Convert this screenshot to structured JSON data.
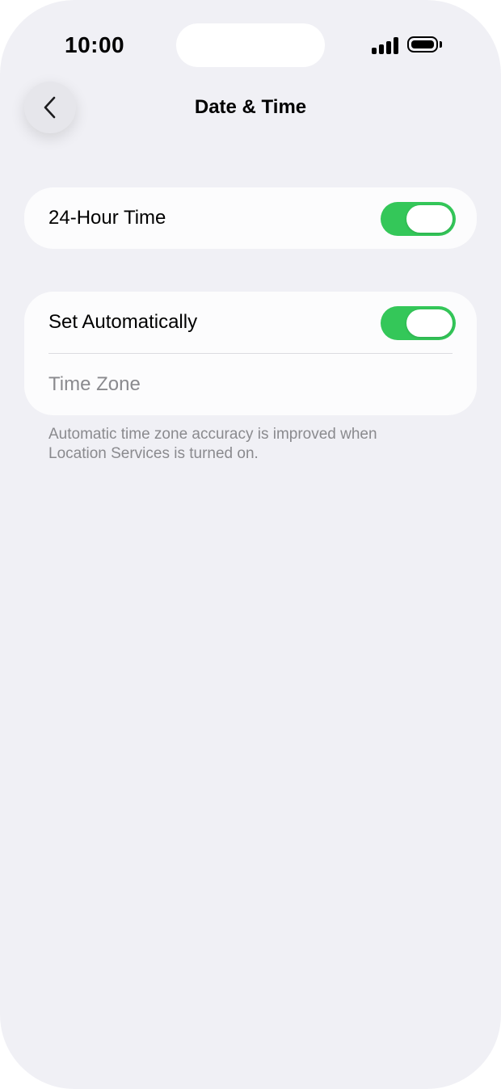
{
  "status_bar": {
    "time": "10:00",
    "signal_icon": "cellular-signal-icon",
    "battery_icon": "battery-icon"
  },
  "nav": {
    "back_icon": "chevron-left-icon",
    "title": "Date & Time"
  },
  "groups": [
    {
      "rows": [
        {
          "label": "24-Hour Time",
          "toggle_on": true
        }
      ]
    },
    {
      "rows": [
        {
          "label": "Set Automatically",
          "toggle_on": true
        },
        {
          "label": "Time Zone",
          "disabled": true
        }
      ]
    }
  ],
  "footnote": "Automatic time zone accuracy is improved when Location Services is turned on.",
  "colors": {
    "background": "#f0f0f5",
    "card": "#fcfcfd",
    "toggle_on": "#34c759",
    "muted_text": "#8a8a8e"
  }
}
